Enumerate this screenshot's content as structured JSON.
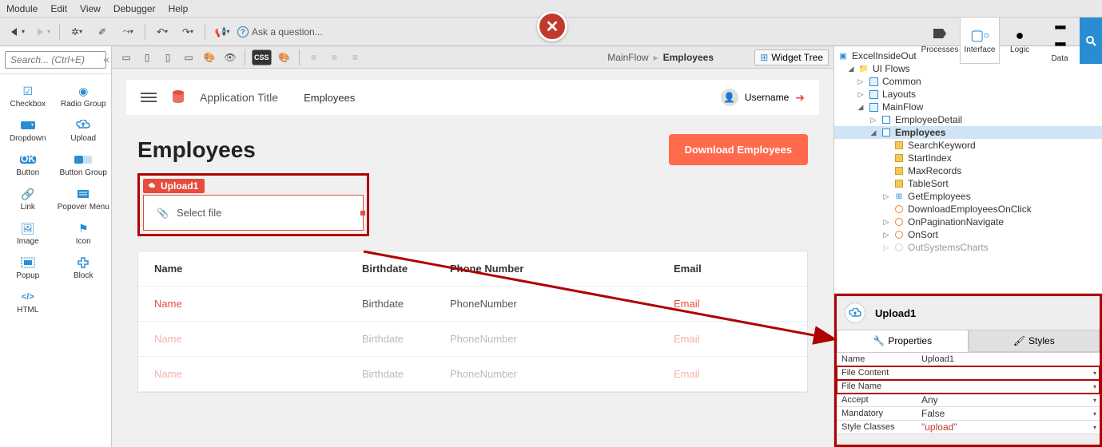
{
  "menubar": [
    "Module",
    "Edit",
    "View",
    "Debugger",
    "Help"
  ],
  "ask_question": "Ask a question...",
  "right_tools": [
    {
      "label": "Processes",
      "icon": "▶"
    },
    {
      "label": "Interface",
      "icon": "⧉",
      "active": true
    },
    {
      "label": "Logic",
      "icon": "●"
    },
    {
      "label": "Data",
      "icon": "⋮⋮⋮"
    }
  ],
  "left_search_placeholder": "Search... (Ctrl+E)",
  "toolbox": [
    [
      {
        "label": "Checkbox",
        "icon": "☑"
      },
      {
        "label": "Radio Group",
        "icon": "◉"
      }
    ],
    [
      {
        "label": "Dropdown",
        "icon": "▭▾"
      },
      {
        "label": "Upload",
        "icon": "☁↑"
      }
    ],
    [
      {
        "label": "Button",
        "icon": "OK"
      },
      {
        "label": "Button Group",
        "icon": "▭▭"
      }
    ],
    [
      {
        "label": "Link",
        "icon": "🔗"
      },
      {
        "label": "Popover Menu",
        "icon": "☰"
      }
    ],
    [
      {
        "label": "Image",
        "icon": "🖼"
      },
      {
        "label": "Icon",
        "icon": "⚑"
      }
    ],
    [
      {
        "label": "Popup",
        "icon": "◫"
      },
      {
        "label": "Block",
        "icon": "✚"
      }
    ],
    [
      {
        "label": "HTML",
        "icon": "</>"
      },
      {
        "label": "",
        "icon": ""
      }
    ]
  ],
  "breadcrumb": {
    "parent": "MainFlow",
    "current": "Employees"
  },
  "widget_tree_label": "Widget Tree",
  "app_header": {
    "title": "Application Title",
    "nav": "Employees",
    "username": "Username"
  },
  "page": {
    "title": "Employees",
    "download_btn": "Download Employees",
    "upload_tag": "Upload1",
    "select_file": "Select file"
  },
  "table": {
    "headers": [
      "Name",
      "Birthdate",
      "Phone Number",
      "Email"
    ],
    "rows": [
      [
        "Name",
        "Birthdate",
        "PhoneNumber",
        "Email"
      ],
      [
        "Name",
        "Birthdate",
        "PhoneNumber",
        "Email"
      ],
      [
        "Name",
        "Birthdate",
        "PhoneNumber",
        "Email"
      ]
    ]
  },
  "tree": [
    {
      "ind": 0,
      "toggle": "▣",
      "icon": "layers",
      "label": "ExcelInsideOut"
    },
    {
      "ind": 1,
      "toggle": "◢",
      "icon": "folder",
      "label": "UI Flows"
    },
    {
      "ind": 2,
      "toggle": "▷",
      "icon": "flow",
      "label": "Common"
    },
    {
      "ind": 2,
      "toggle": "▷",
      "icon": "flow",
      "label": "Layouts"
    },
    {
      "ind": 2,
      "toggle": "◢",
      "icon": "flow",
      "label": "MainFlow"
    },
    {
      "ind": 3,
      "toggle": "▷",
      "icon": "screen",
      "label": "EmployeeDetail"
    },
    {
      "ind": 3,
      "toggle": "◢",
      "icon": "screen",
      "label": "Employees",
      "selected": true
    },
    {
      "ind": 4,
      "toggle": "",
      "icon": "var",
      "label": "SearchKeyword"
    },
    {
      "ind": 4,
      "toggle": "",
      "icon": "var",
      "label": "StartIndex"
    },
    {
      "ind": 4,
      "toggle": "",
      "icon": "var",
      "label": "MaxRecords"
    },
    {
      "ind": 4,
      "toggle": "",
      "icon": "var",
      "label": "TableSort"
    },
    {
      "ind": 4,
      "toggle": "▷",
      "icon": "agg",
      "label": "GetEmployees"
    },
    {
      "ind": 4,
      "toggle": "",
      "icon": "action",
      "label": "DownloadEmployeesOnClick"
    },
    {
      "ind": 4,
      "toggle": "▷",
      "icon": "action",
      "label": "OnPaginationNavigate"
    },
    {
      "ind": 4,
      "toggle": "▷",
      "icon": "action",
      "label": "OnSort"
    },
    {
      "ind": 4,
      "toggle": "▷",
      "icon": "action-grey",
      "label": "OutSystemsCharts"
    }
  ],
  "properties": {
    "widget_name": "Upload1",
    "tabs": [
      "Properties",
      "Styles"
    ],
    "rows": [
      {
        "key": "Name",
        "val": "Upload1",
        "hl": false
      },
      {
        "key": "File Content",
        "val": "",
        "hl": true,
        "dd": true
      },
      {
        "key": "File Name",
        "val": "",
        "hl": true,
        "dd": true
      },
      {
        "key": "Accept",
        "val": "Any",
        "hl": false,
        "dd": true
      },
      {
        "key": "Mandatory",
        "val": "False",
        "hl": false,
        "dd": true
      },
      {
        "key": "Style Classes",
        "val": "\"upload\"",
        "hl": false,
        "red": true,
        "dd": true
      }
    ]
  }
}
